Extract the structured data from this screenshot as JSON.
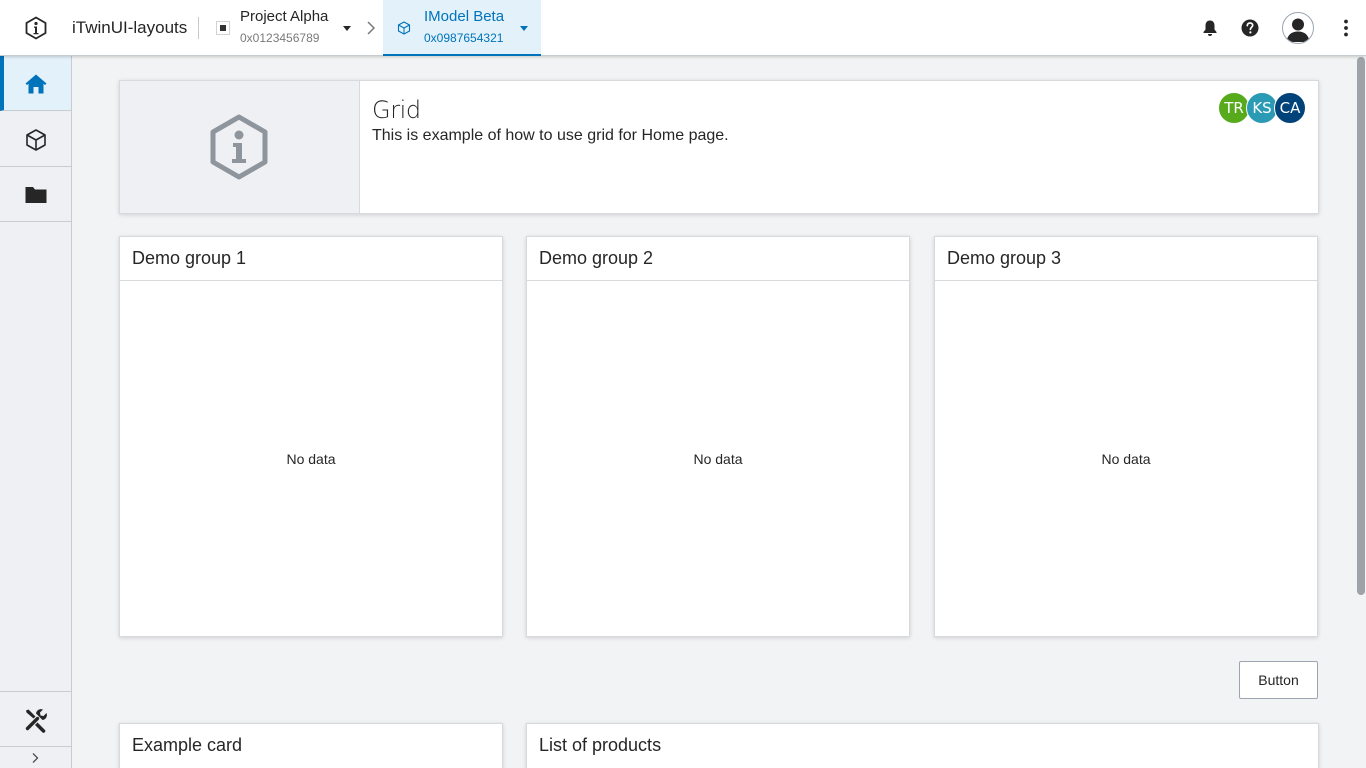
{
  "header": {
    "app_title": "iTwinUI-layouts",
    "project": {
      "title": "Project Alpha",
      "id": "0x0123456789"
    },
    "imodel": {
      "title": "IModel Beta",
      "id": "0x0987654321"
    },
    "icons": [
      "itwin-logo-icon",
      "project-square-icon",
      "chevron-right-icon",
      "imodel-cube-icon",
      "bell-icon",
      "help-icon",
      "user-avatar-icon",
      "more-vertical-icon"
    ]
  },
  "sidebar": {
    "items": [
      {
        "icon": "home-icon",
        "active": true
      },
      {
        "icon": "cube-icon",
        "active": false
      },
      {
        "icon": "folder-icon",
        "active": false
      }
    ],
    "bottom": {
      "icon": "tools-icon"
    },
    "expand": {
      "icon": "chevron-right-icon"
    }
  },
  "info_tile": {
    "name": "Grid",
    "description": "This is example of how to use grid for Home page.",
    "thumbnail_icon": "info-hexagon-icon",
    "avatars": [
      {
        "initials": "TR",
        "color": "#56aa1c"
      },
      {
        "initials": "KS",
        "color": "#2a9ab5"
      },
      {
        "initials": "CA",
        "color": "#00427a"
      }
    ]
  },
  "groups": [
    {
      "title": "Demo group 1",
      "empty_text": "No data"
    },
    {
      "title": "Demo group 2",
      "empty_text": "No data"
    },
    {
      "title": "Demo group 3",
      "empty_text": "No data"
    }
  ],
  "button_label": "Button",
  "bottom_cards": [
    {
      "title": "Example card"
    },
    {
      "title": "List of products"
    }
  ],
  "colors": {
    "accent": "#0073ba",
    "accent_bg": "#e3f1fa",
    "page_bg": "#f2f3f4"
  }
}
